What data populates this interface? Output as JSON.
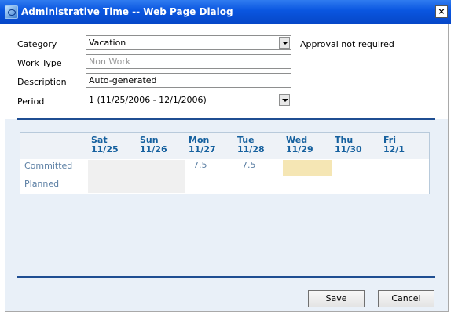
{
  "window": {
    "title": "Administrative Time -- Web Page Dialog",
    "close_glyph": "×"
  },
  "form": {
    "category": {
      "label": "Category",
      "value": "Vacation",
      "note": "Approval not required"
    },
    "work_type": {
      "label": "Work Type",
      "value": "Non Work"
    },
    "description": {
      "label": "Description",
      "value": "Auto-generated"
    },
    "period": {
      "label": "Period",
      "value": "1 (11/25/2006 - 12/1/2006)"
    }
  },
  "grid": {
    "days": [
      {
        "dow": "Sat",
        "date": "11/25"
      },
      {
        "dow": "Sun",
        "date": "11/26"
      },
      {
        "dow": "Mon",
        "date": "11/27"
      },
      {
        "dow": "Tue",
        "date": "11/28"
      },
      {
        "dow": "Wed",
        "date": "11/29"
      },
      {
        "dow": "Thu",
        "date": "11/30"
      },
      {
        "dow": "Fri",
        "date": "12/1"
      }
    ],
    "rows": [
      {
        "label": "Committed",
        "values": [
          "",
          "",
          "7.5",
          "7.5",
          "",
          "",
          ""
        ]
      },
      {
        "label": "Planned",
        "values": [
          "",
          "",
          "",
          "",
          "",
          "",
          ""
        ]
      }
    ]
  },
  "buttons": {
    "save": "Save",
    "cancel": "Cancel"
  },
  "colors": {
    "title_bar": "#0a56e0",
    "accent_line": "#1f4e92",
    "header_text": "#15609e",
    "today_cell": "#f5e6b4"
  }
}
